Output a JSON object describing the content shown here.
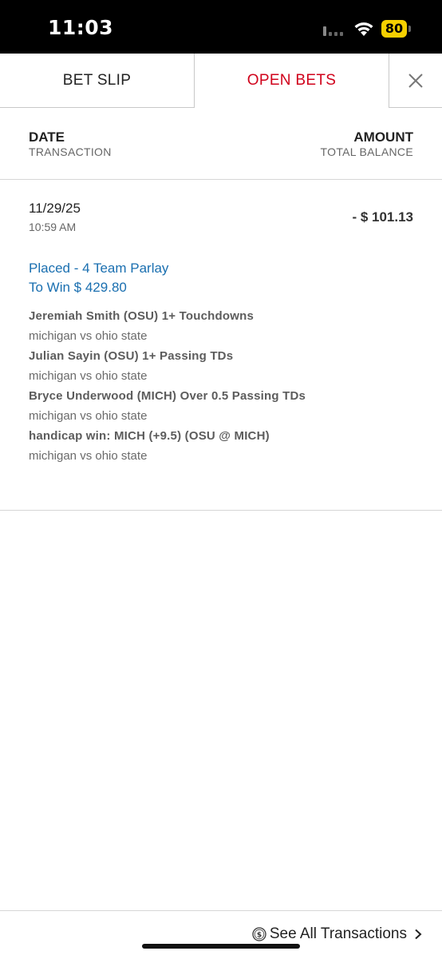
{
  "status_bar": {
    "time": "11:03",
    "battery": "80",
    "battery_color": "#f5d000"
  },
  "tabs": {
    "bet_slip": "BET SLIP",
    "open_bets": "OPEN BETS",
    "active_color": "#d0021b",
    "close_icon": "close-icon"
  },
  "header": {
    "date": "DATE",
    "transaction": "TRANSACTION",
    "amount": "AMOUNT",
    "total_balance": "TOTAL BALANCE"
  },
  "transaction": {
    "date": "11/29/25",
    "time": "10:59 AM",
    "amount": "- $ 101.13",
    "placed": "Placed - 4 Team Parlay",
    "to_win": "To Win $ 429.80",
    "link_color": "#1a6fb0",
    "legs": [
      {
        "title": "Jeremiah Smith (OSU) 1+ Touchdowns",
        "game": "michigan vs ohio state"
      },
      {
        "title": "Julian Sayin (OSU) 1+ Passing TDs",
        "game": "michigan vs ohio state"
      },
      {
        "title": "Bryce Underwood (MICH) Over 0.5 Passing TDs",
        "game": "michigan vs ohio state"
      },
      {
        "title": "handicap win: MICH (+9.5) (OSU @ MICH)",
        "game": "michigan vs ohio state"
      }
    ]
  },
  "footer": {
    "see_all": "See All Transactions",
    "icon": "dollar-circle-icon",
    "chevron": "chevron-right-icon"
  }
}
